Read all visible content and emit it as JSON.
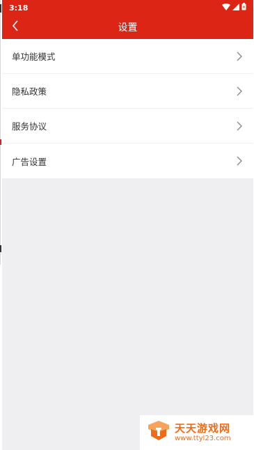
{
  "statusbar": {
    "time": "3:18",
    "icons": [
      "wifi-icon",
      "signal-icon",
      "battery-icon"
    ]
  },
  "header": {
    "title": "设置",
    "back_icon": "chevron-left-icon"
  },
  "settings": {
    "items": [
      {
        "label": "单功能模式"
      },
      {
        "label": "隐私政策"
      },
      {
        "label": "服务协议"
      },
      {
        "label": "广告设置"
      }
    ]
  },
  "watermark": {
    "brand": "天天游戏网",
    "url": "www.ttyl23.com"
  },
  "colors": {
    "accent": "#dd2515",
    "background": "#efeff1",
    "row_text": "#333333",
    "chevron": "#8a8a8a",
    "watermark": "#f06a1a"
  }
}
